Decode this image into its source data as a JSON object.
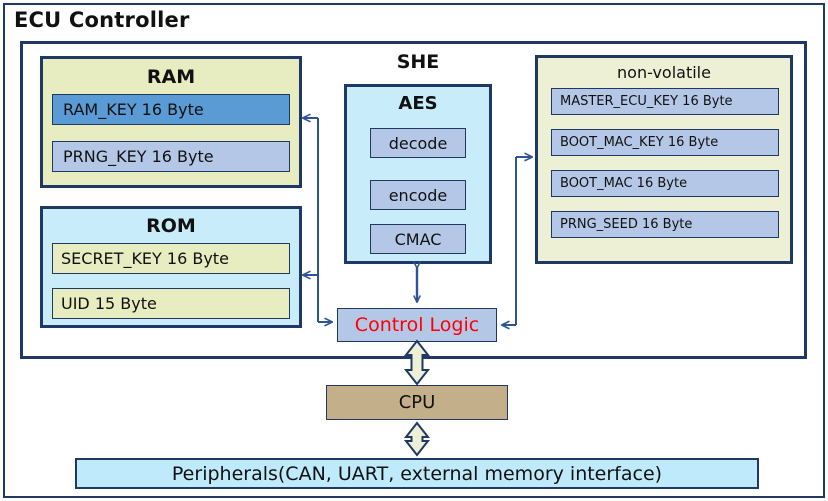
{
  "diagram": {
    "title": "ECU Controller",
    "colors": {
      "border": "#1f3864",
      "ram_fill": "#e8ecc1",
      "rom_fill": "#c9ecfb",
      "nonvolatile_fill": "#eef0d5",
      "slot_blue": "#b4c7e7",
      "slot_blue_strong": "#5b9bd5",
      "slot_yellow": "#e8ecc1",
      "cpu_fill": "#c3b08a",
      "peripherals_fill": "#bfeafb",
      "control_logic_text": "#ff0000",
      "arrow": "#2e5496",
      "block_arrow_fill": "#eef0d5"
    }
  },
  "ram": {
    "title": "RAM",
    "slots": [
      {
        "name": "RAM_KEY",
        "size": "16 Byte",
        "label": "RAM_KEY   16 Byte"
      },
      {
        "name": "PRNG_KEY",
        "size": "16 Byte",
        "label": "PRNG_KEY   16 Byte"
      }
    ]
  },
  "rom": {
    "title": "ROM",
    "slots": [
      {
        "name": "SECRET_KEY",
        "size": "16 Byte",
        "label": "SECRET_KEY   16 Byte"
      },
      {
        "name": "UID",
        "size": "15 Byte",
        "label": "UID   15 Byte"
      }
    ]
  },
  "she": {
    "title": "SHE",
    "aes": {
      "title": "AES",
      "ops": [
        {
          "label": "decode"
        },
        {
          "label": "encode"
        },
        {
          "label": "CMAC"
        }
      ]
    }
  },
  "nonvolatile": {
    "title": "non-volatile",
    "slots": [
      {
        "name": "MASTER_ECU_KEY",
        "size": "16 Byte",
        "label": "MASTER_ECU_KEY   16 Byte"
      },
      {
        "name": "BOOT_MAC_KEY",
        "size": "16 Byte",
        "label": "BOOT_MAC_KEY   16 Byte"
      },
      {
        "name": "BOOT_MAC",
        "size": "16 Byte",
        "label": "BOOT_MAC   16 Byte"
      },
      {
        "name": "PRNG_SEED",
        "size": "16 Byte",
        "label": "PRNG_SEED   16 Byte"
      }
    ]
  },
  "control_logic": {
    "label": "Control Logic"
  },
  "cpu": {
    "label": "CPU"
  },
  "peripherals": {
    "label": "Peripherals(CAN, UART, external memory interface)"
  }
}
